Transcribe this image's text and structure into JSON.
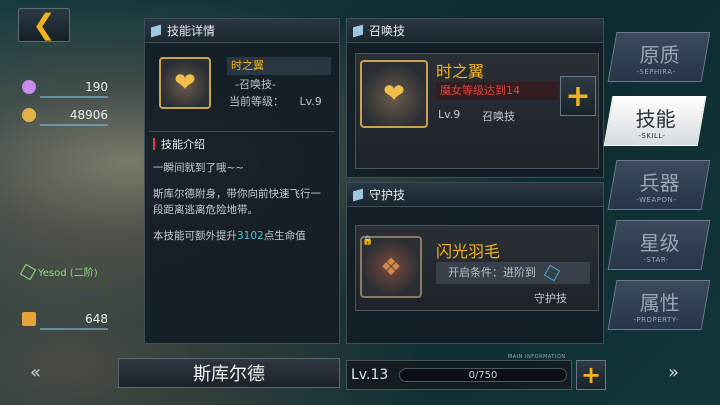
{
  "resources": {
    "crystal": "190",
    "coin": "48906",
    "medal": "648"
  },
  "character": {
    "sephira": "Yesod (二阶)",
    "name": "斯库尔德",
    "level": "Lv.13",
    "xp": "0/750"
  },
  "detail": {
    "header": "技能详情",
    "skill_name": "时之翼",
    "skill_type": "-召唤技-",
    "current_level_label": "当前等级：",
    "current_level": "Lv.9",
    "intro_header": "技能介绍",
    "desc1": "一瞬间就到了哦~~",
    "desc2": "斯库尔德附身，带你向前快速飞行一段距离逃离危险地带。",
    "desc3_prefix": "本技能可额外提升",
    "desc3_value": "3102",
    "desc3_suffix": "点生命值"
  },
  "summon": {
    "header": "召唤技",
    "name": "时之翼",
    "req": "魔女等级达到14",
    "level": "Lv.9",
    "type": "召唤技"
  },
  "guard": {
    "header": "守护技",
    "name": "闪光羽毛",
    "cond": "开启条件：进阶到",
    "type": "守护技"
  },
  "tabs": [
    {
      "cn": "原质",
      "en": "-SEPHIRA-"
    },
    {
      "cn": "技能",
      "en": "-SKILL-"
    },
    {
      "cn": "兵器",
      "en": "-WEAPON-"
    },
    {
      "cn": "星级",
      "en": "-STAR-"
    },
    {
      "cn": "属性",
      "en": "-PROPERTY-"
    }
  ],
  "main_info": "MAIN INFORMATION",
  "colors": {
    "accent": "#f3b21c",
    "req_red": "#e0423a",
    "highlight": "#49c6d6"
  }
}
